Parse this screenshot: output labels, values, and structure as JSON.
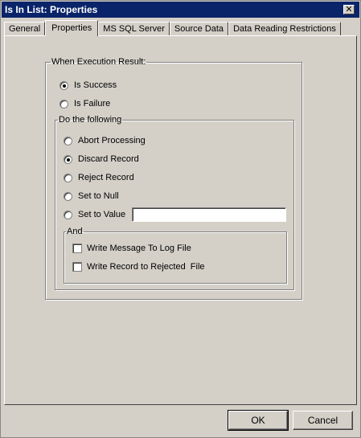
{
  "window": {
    "title": "Is In List: Properties",
    "close_label": "✕"
  },
  "tabs": [
    {
      "label": "General"
    },
    {
      "label": "Properties"
    },
    {
      "label": "MS SQL Server"
    },
    {
      "label": "Source Data"
    },
    {
      "label": "Data Reading Restrictions"
    }
  ],
  "active_tab": "Properties",
  "execution_result": {
    "legend": "When Execution Result:",
    "options": [
      {
        "label": "Is Success",
        "selected": true
      },
      {
        "label": "Is Failure",
        "selected": false
      }
    ]
  },
  "do_following": {
    "legend": "Do the following",
    "options": [
      {
        "label": "Abort Processing",
        "selected": false
      },
      {
        "label": "Discard Record",
        "selected": true
      },
      {
        "label": "Reject Record",
        "selected": false
      },
      {
        "label": "Set to Null",
        "selected": false
      },
      {
        "label": "Set to Value",
        "selected": false
      }
    ],
    "set_value_input": ""
  },
  "and_group": {
    "legend": "And",
    "checks": [
      {
        "label": "Write Message To Log File",
        "checked": false
      },
      {
        "label": "Write Record to Rejected  File",
        "checked": false
      }
    ]
  },
  "buttons": {
    "ok": "OK",
    "cancel": "Cancel"
  }
}
